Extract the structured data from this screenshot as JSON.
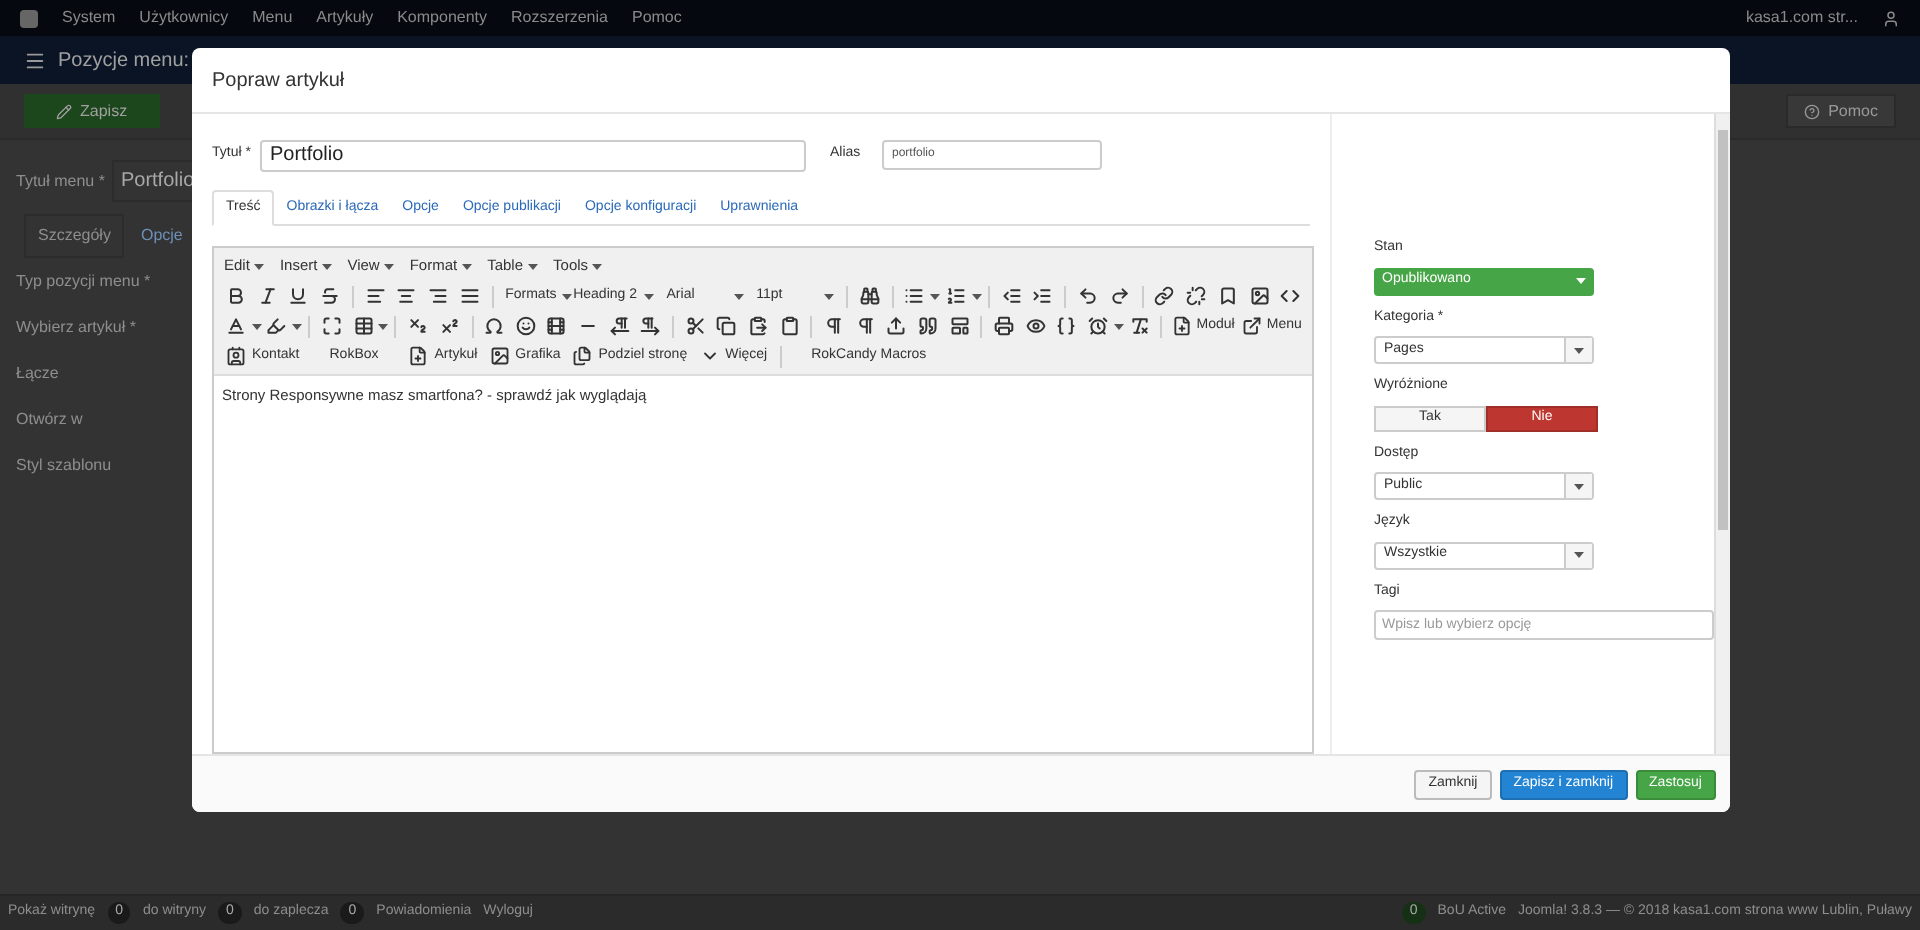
{
  "background": {
    "top_menu": [
      "System",
      "Użytkownicy",
      "Menu",
      "Artykuły",
      "Komponenty",
      "Rozszerzenia",
      "Pomoc"
    ],
    "site_link": "kasa1.com str...",
    "page_title": "Pozycje menu:",
    "save_button": "Zapisz",
    "help_button": "Pomoc",
    "menu_title": {
      "label": "Tytuł menu *",
      "value": "Portfolio"
    },
    "tabs": [
      {
        "label": "Szczegóły",
        "selected": true
      },
      {
        "label": "Opcje",
        "selected": false
      }
    ],
    "labels": [
      "Typ pozycji menu *",
      "Wybierz artykuł *",
      "Łącze",
      "Otwórz w",
      "Styl szablonu"
    ],
    "status_bar": {
      "view_site": "Pokaż witrynę",
      "counters": [
        {
          "badge": "0",
          "label": "do witryny"
        },
        {
          "badge": "0",
          "label": "do zaplecza"
        },
        {
          "badge": "0",
          "label": "Powiadomienia"
        }
      ],
      "logout": "Wyloguj",
      "right_badge": "0",
      "right_label": "BoU Active",
      "copyright": "Joomla! 3.8.3 — © 2018 kasa1.com strona www Lublin, Puławy"
    }
  },
  "modal": {
    "title": "Popraw artykuł",
    "title_field": {
      "label": "Tytuł *",
      "value": "Portfolio"
    },
    "alias_field": {
      "label": "Alias",
      "value": "portfolio"
    },
    "tabs": [
      {
        "label": "Treść",
        "selected": true
      },
      {
        "label": "Obrazki i łącza",
        "selected": false
      },
      {
        "label": "Opcje",
        "selected": false
      },
      {
        "label": "Opcje publikacji",
        "selected": false
      },
      {
        "label": "Opcje konfiguracji",
        "selected": false
      },
      {
        "label": "Uprawnienia",
        "selected": false
      }
    ],
    "editor": {
      "menus": [
        "Edit",
        "Insert",
        "View",
        "Format",
        "Table",
        "Tools"
      ],
      "dropdowns": [
        "Formats",
        "Heading 2",
        "Arial",
        "11pt"
      ],
      "buttons": [
        "Moduł",
        "Menu"
      ],
      "plugin_buttons": [
        {
          "label": "Kontakt",
          "kind": "icon"
        },
        {
          "label": "RokBox",
          "kind": "plain"
        },
        {
          "label": "Artykuł",
          "kind": "icon"
        },
        {
          "label": "Grafika",
          "kind": "icon"
        },
        {
          "label": "Podziel stronę",
          "kind": "icon"
        },
        {
          "label": "Więcej",
          "kind": "icon"
        },
        {
          "label": "RokCandy Macros",
          "kind": "plain"
        }
      ],
      "content": "Strony Responsywne masz smartfona? - sprawdź jak wyglądają"
    },
    "side_fields": [
      {
        "label": "Stan",
        "kind": "status_select",
        "value": "Opublikowano"
      },
      {
        "label": "Kategoria *",
        "kind": "select",
        "value": "Pages"
      },
      {
        "label": "Wyróżnione",
        "kind": "toggle",
        "options": [
          {
            "label": "Tak",
            "selected": false
          },
          {
            "label": "Nie",
            "selected": true
          }
        ]
      },
      {
        "label": "Dostęp",
        "kind": "select",
        "value": "Public"
      },
      {
        "label": "Język",
        "kind": "select",
        "value": "Wszystkie"
      },
      {
        "label": "Tagi",
        "kind": "tags",
        "placeholder": "Wpisz lub wybierz opcję"
      }
    ],
    "footer_buttons": [
      {
        "label": "Zamknij",
        "kind": "default"
      },
      {
        "label": "Zapisz i zamknij",
        "kind": "primary"
      },
      {
        "label": "Zastosuj",
        "kind": "success"
      }
    ]
  }
}
